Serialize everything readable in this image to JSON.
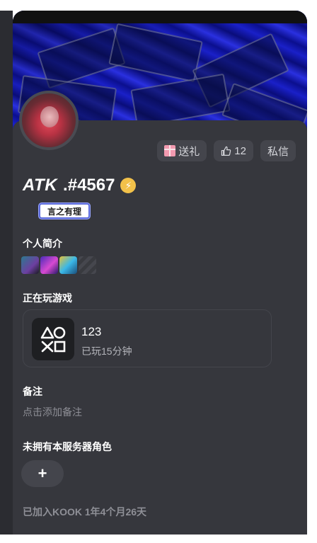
{
  "profile": {
    "username": "ATK",
    "tag": ".#4567",
    "medal_text": "言之有理"
  },
  "actions": {
    "gift_label": "送礼",
    "like_count": "12",
    "message_label": "私信"
  },
  "sections": {
    "bio_title": "个人简介",
    "playing_title": "正在玩游戏",
    "note_title": "备注",
    "note_placeholder": "点击添加备注",
    "roles_title": "未拥有本服务器角色",
    "add_role_label": "+",
    "joined_text": "已加入KOOK 1年4个月26天"
  },
  "game": {
    "name": "123",
    "duration": "已玩15分钟"
  },
  "icons": {
    "gift": "gift-icon",
    "like": "thumbs-up-icon",
    "verified": "lightning-bolt-icon",
    "game": "playstation-symbols-icon"
  },
  "colors": {
    "card_bg": "#36373d",
    "pill_bg": "#44454c",
    "verified_badge": "#f2c14a",
    "banner": "#1a20c8"
  }
}
